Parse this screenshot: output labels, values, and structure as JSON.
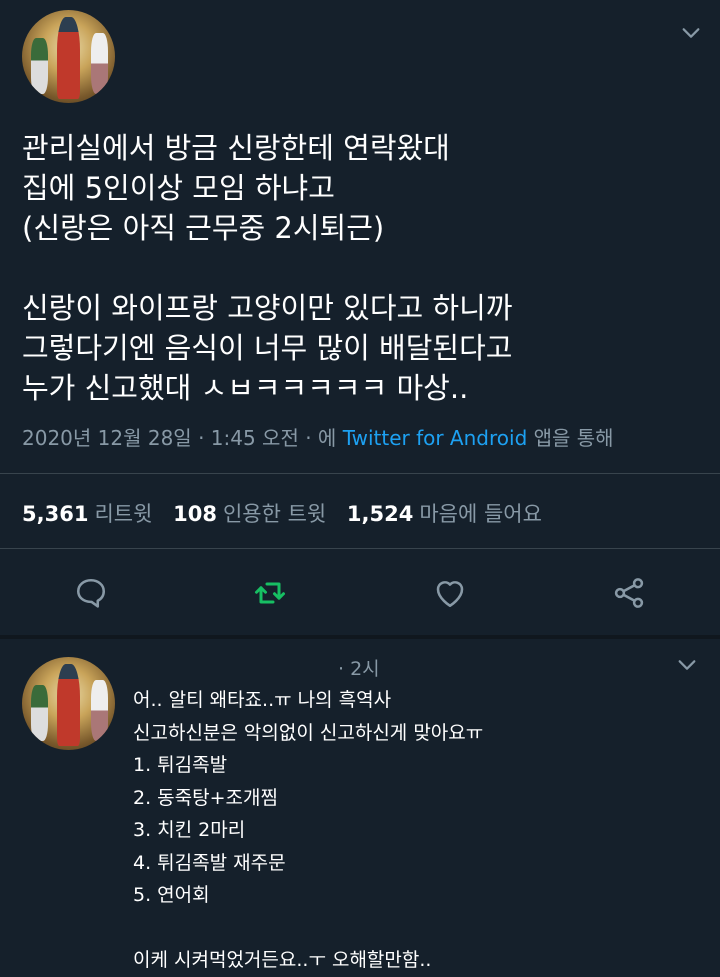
{
  "tweet": {
    "text": "관리실에서 방금 신랑한테 연락왔대\n집에 5인이상 모임 하냐고\n(신랑은 아직 근무중 2시퇴근)\n\n신랑이 와이프랑 고양이만 있다고 하니까\n그렇다기엔 음식이 너무 많이 배달된다고\n누가 신고했대 ㅅㅂㅋㅋㅋㅋㅋ 마상..",
    "meta_prefix": "2020년 12월 28일 · 1:45 오전 · 에 ",
    "meta_source": "Twitter for Android",
    "meta_suffix": " 앱을 통해",
    "stats": {
      "retweets_count": "5,361",
      "retweets_label": "리트윗",
      "quotes_count": "108",
      "quotes_label": "인용한 트윗",
      "likes_count": "1,524",
      "likes_label": "마음에 들어요"
    }
  },
  "reply": {
    "time": "· 2시",
    "text": "어.. 알티 왜타죠..ㅠ 나의 흑역사\n신고하신분은 악의없이 신고하신게 맞아요ㅠ\n1. 튀김족발\n2. 동죽탕+조개찜\n3. 치킨 2마리\n4. 튀김족발 재주문\n5. 연어회\n\n이케 시켜먹었거든요..ㅜ 오해할만함.."
  },
  "colors": {
    "background": "#15202b",
    "secondary_text": "#8899a6",
    "link": "#1da1f2",
    "retweet_accent": "#17bf63",
    "divider": "#38444d"
  },
  "icons": {
    "reply": "comment-icon",
    "retweet": "retweet-icon",
    "like": "heart-icon",
    "share": "share-icon",
    "more": "chevron-down-icon"
  }
}
